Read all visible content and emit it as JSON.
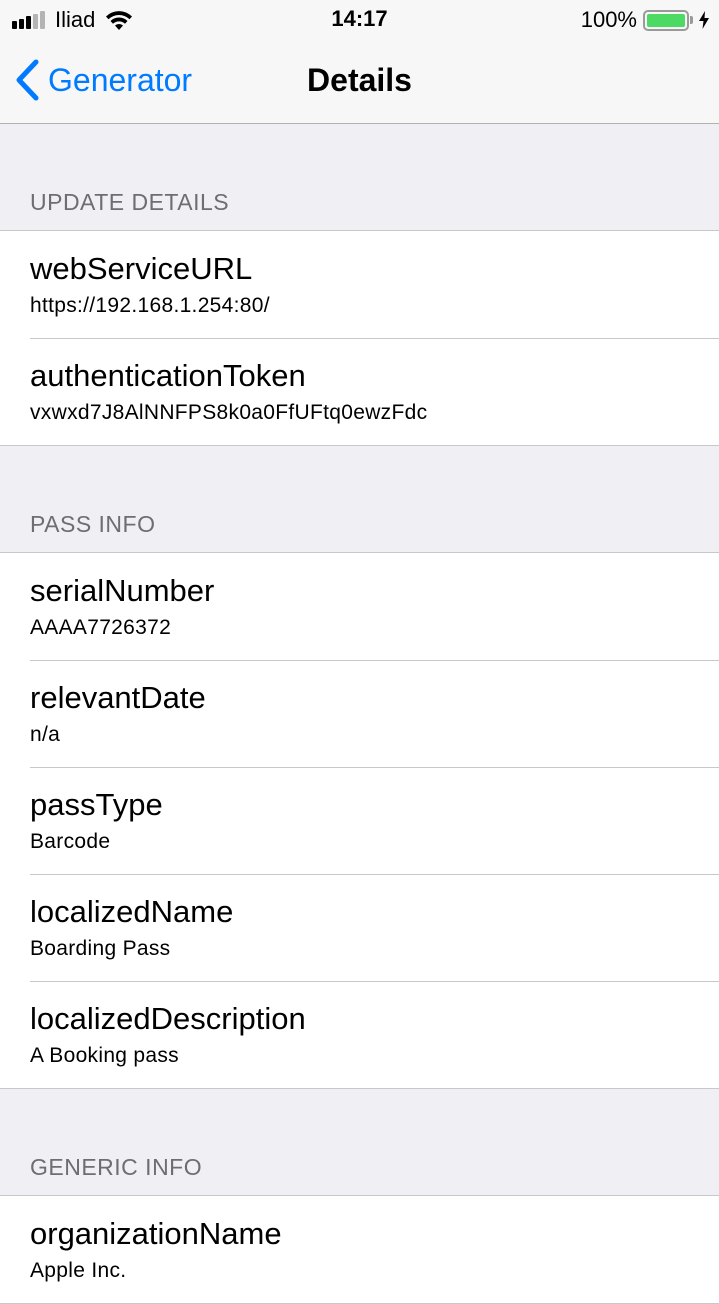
{
  "status_bar": {
    "carrier": "Iliad",
    "time": "14:17",
    "battery_percent": "100%",
    "battery_level": 1.0,
    "battery_color": "#4cd964",
    "signal_bars_filled": 3,
    "signal_bars_total": 5,
    "icons": [
      "signal-icon",
      "wifi-icon",
      "battery-icon",
      "charging-bolt-icon"
    ]
  },
  "nav": {
    "back_label": "Generator",
    "title": "Details",
    "accent_color": "#007aff",
    "back_icon": "chevron-left-icon"
  },
  "sections": [
    {
      "header": "UPDATE DETAILS",
      "rows": [
        {
          "title": "webServiceURL",
          "value": "https://192.168.1.254:80/"
        },
        {
          "title": "authenticationToken",
          "value": "vxwxd7J8AlNNFPS8k0a0FfUFtq0ewzFdc"
        }
      ]
    },
    {
      "header": "PASS INFO",
      "rows": [
        {
          "title": "serialNumber",
          "value": "AAAA7726372"
        },
        {
          "title": "relevantDate",
          "value": "n/a"
        },
        {
          "title": "passType",
          "value": "Barcode"
        },
        {
          "title": "localizedName",
          "value": "Boarding Pass"
        },
        {
          "title": "localizedDescription",
          "value": "A Booking pass"
        }
      ]
    },
    {
      "header": "GENERIC INFO",
      "rows": [
        {
          "title": "organizationName",
          "value": "Apple Inc."
        }
      ]
    }
  ]
}
